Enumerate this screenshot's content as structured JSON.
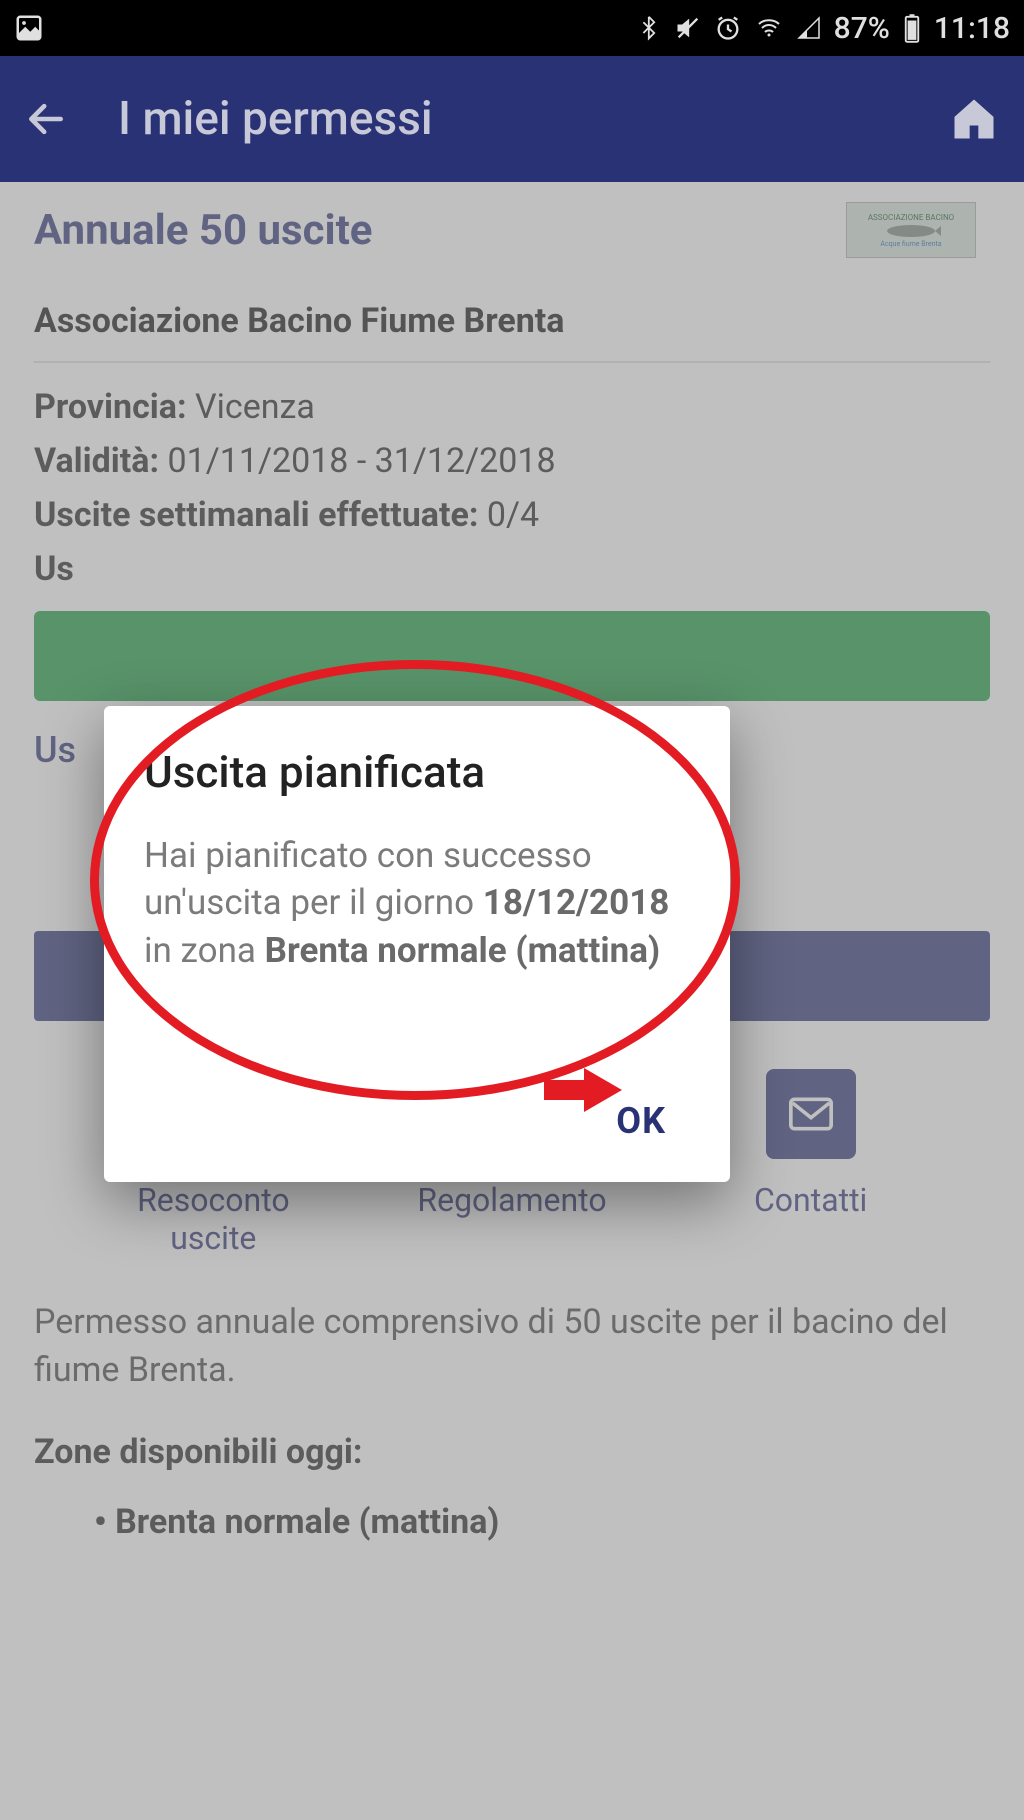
{
  "statusbar": {
    "battery": "87%",
    "time": "11:18"
  },
  "appbar": {
    "title": "I miei permessi"
  },
  "permit": {
    "title": "Annuale 50 uscite",
    "logo_text_top": "ASSOCIAZIONE BACINO",
    "logo_text_bottom": "Acque fiume Brenta",
    "association": "Associazione Bacino Fiume Brenta",
    "province_label": "Provincia:",
    "province_value": " Vicenza",
    "validity_label": "Validità:",
    "validity_value": " 01/11/2018 - 31/12/2018",
    "weekly_label": "Uscite settimanali effettuate:",
    "weekly_value": " 0/4",
    "partial_us": "Us",
    "us_label": "Us"
  },
  "actions": {
    "resoconto": "Resoconto uscite",
    "regolamento": "Regolamento",
    "contatti": "Contatti"
  },
  "description": "Permesso annuale comprensivo di 50 uscite per il bacino del fiume Brenta.",
  "zones": {
    "title": "Zone disponibili oggi:",
    "item1": "Brenta normale (mattina)"
  },
  "dialog": {
    "title": "Uscita pianificata",
    "msg_1": "Hai pianificato con successo un'uscita per il giorno ",
    "msg_date": "18/12/2018",
    "msg_2": " in zona ",
    "msg_zone": "Brenta normale (mattina)",
    "ok": "OK"
  }
}
